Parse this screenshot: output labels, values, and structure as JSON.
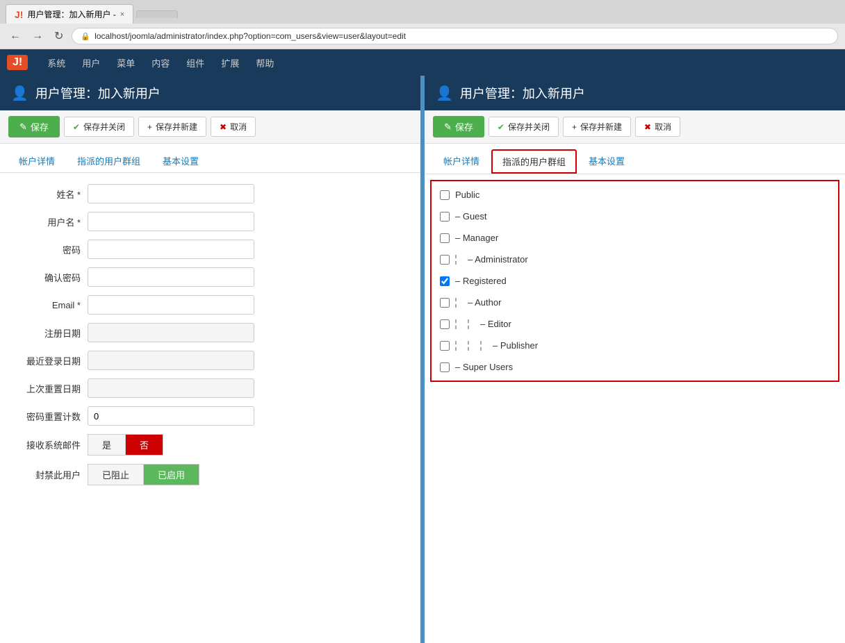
{
  "browser": {
    "tab_title": "用户管理：加入新用户 -",
    "tab_close": "×",
    "address": "localhost/joomla/administrator/index.php?option=com_users&view=user&layout=edit"
  },
  "nav": {
    "logo": "J!",
    "items": [
      "系统",
      "用户",
      "菜单",
      "内容",
      "组件",
      "扩展",
      "帮助"
    ]
  },
  "left_panel": {
    "header_icon": "👤",
    "header_title": "用户管理：加入新用户",
    "toolbar": {
      "save": "保存",
      "save_close": "保存并关闭",
      "save_new": "保存并新建",
      "cancel": "取消"
    },
    "tabs": [
      {
        "label": "帐户详情",
        "active": false
      },
      {
        "label": "指派的用户群组",
        "active": false
      },
      {
        "label": "基本设置",
        "active": false
      }
    ],
    "form": {
      "name_label": "姓名 *",
      "username_label": "用户名 *",
      "password_label": "密码",
      "confirm_password_label": "确认密码",
      "email_label": "Email *",
      "register_date_label": "注册日期",
      "last_visit_label": "最近登录日期",
      "last_reset_label": "上次重置日期",
      "reset_count_label": "密码重置计数",
      "reset_count_value": "0",
      "receive_email_label": "接收系统邮件",
      "block_label": "封禁此用户",
      "yes_btn": "是",
      "no_btn": "否",
      "blocked_btn": "已阻止",
      "enabled_btn": "已启用"
    }
  },
  "right_panel": {
    "header_icon": "👤",
    "header_title": "用户管理：加入新用户",
    "toolbar": {
      "save": "保存",
      "save_close": "保存并关闭",
      "save_new": "保存并新建",
      "cancel": "取消"
    },
    "tabs": [
      {
        "label": "帐户详情",
        "active": false
      },
      {
        "label": "指派的用户群组",
        "active": true
      },
      {
        "label": "基本设置",
        "active": false
      }
    ],
    "groups": [
      {
        "name": "Public",
        "checked": false,
        "indent": 0
      },
      {
        "name": "– Guest",
        "checked": false,
        "indent": 1
      },
      {
        "name": "– Manager",
        "checked": false,
        "indent": 1
      },
      {
        "name": "– Administrator",
        "checked": false,
        "indent": 2
      },
      {
        "name": "– Registered",
        "checked": true,
        "indent": 1
      },
      {
        "name": "– Author",
        "checked": false,
        "indent": 2
      },
      {
        "name": "– Editor",
        "checked": false,
        "indent": 3
      },
      {
        "name": "– Publisher",
        "checked": false,
        "indent": 4
      },
      {
        "name": "– Super Users",
        "checked": false,
        "indent": 1
      }
    ]
  }
}
